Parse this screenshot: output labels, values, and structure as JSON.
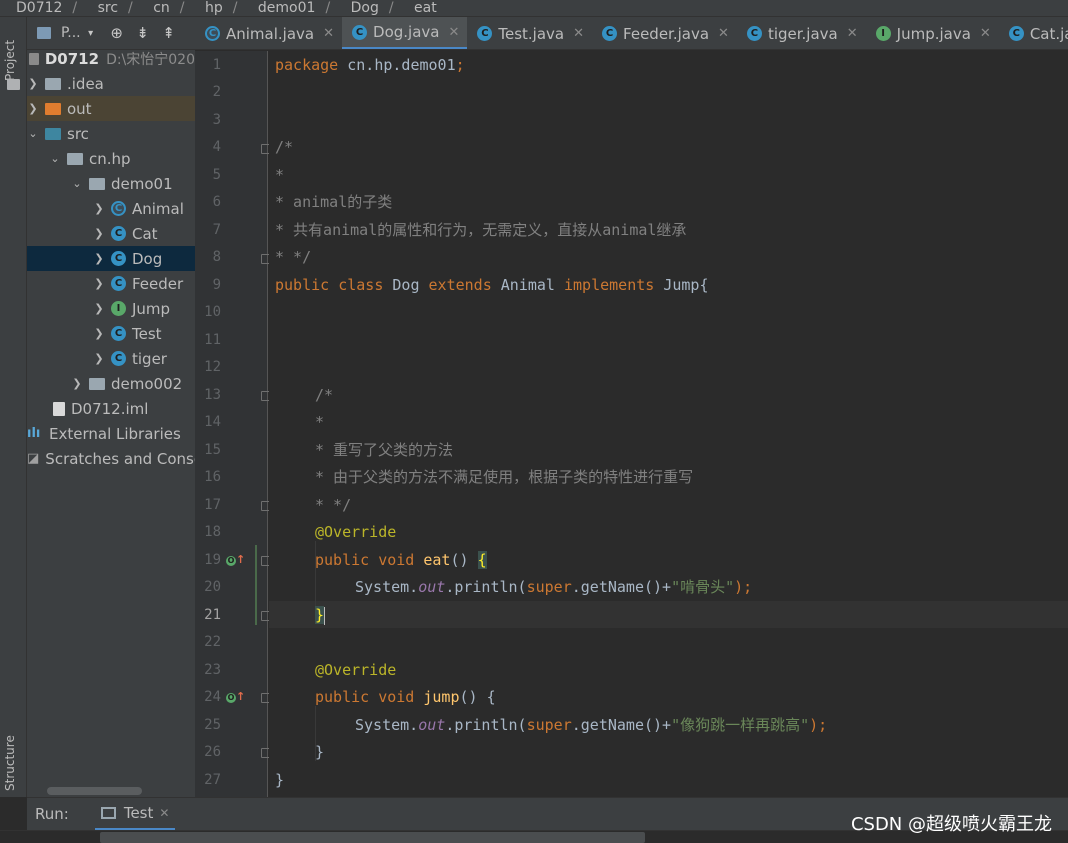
{
  "breadcrumb": [
    "D0712",
    "src",
    "cn",
    "hp",
    "demo01",
    "Dog",
    "eat"
  ],
  "left_stripe": {
    "project": "Project",
    "structure": "Structure"
  },
  "project_panel": {
    "title": "P..."
  },
  "tree": [
    {
      "label": "D0712",
      "extra": "D:\\宋怡宁020",
      "kind": "module"
    },
    {
      "label": ".idea",
      "kind": "folder"
    },
    {
      "label": "out",
      "kind": "folder-out"
    },
    {
      "label": "src",
      "kind": "folder-src"
    },
    {
      "label": "cn.hp",
      "kind": "package"
    },
    {
      "label": "demo01",
      "kind": "package"
    },
    {
      "label": "Animal",
      "kind": "class"
    },
    {
      "label": "Cat",
      "kind": "class"
    },
    {
      "label": "Dog",
      "kind": "class"
    },
    {
      "label": "Feeder",
      "kind": "class"
    },
    {
      "label": "Jump",
      "kind": "interface"
    },
    {
      "label": "Test",
      "kind": "class"
    },
    {
      "label": "tiger",
      "kind": "class"
    },
    {
      "label": "demo002",
      "kind": "package"
    },
    {
      "label": "D0712.iml",
      "kind": "file"
    },
    {
      "label": "External Libraries",
      "kind": "libs"
    },
    {
      "label": "Scratches and Consoles",
      "kind": "scratch"
    }
  ],
  "tabs": [
    {
      "label": "Animal.java",
      "icon": "class-icon"
    },
    {
      "label": "Dog.java",
      "icon": "class-icon",
      "active": true
    },
    {
      "label": "Test.java",
      "icon": "class-icon"
    },
    {
      "label": "Feeder.java",
      "icon": "class-icon"
    },
    {
      "label": "tiger.java",
      "icon": "class-icon"
    },
    {
      "label": "Jump.java",
      "icon": "interface-icon"
    },
    {
      "label": "Cat.java",
      "icon": "class-icon"
    }
  ],
  "line_numbers": [
    "1",
    "2",
    "3",
    "4",
    "5",
    "6",
    "7",
    "8",
    "9",
    "10",
    "11",
    "12",
    "13",
    "14",
    "15",
    "16",
    "17",
    "18",
    "19",
    "20",
    "21",
    "22",
    "23",
    "24",
    "25",
    "26",
    "27"
  ],
  "current_line": "21",
  "code": {
    "l1_a": "package",
    "l1_b": " cn.hp.demo01",
    "l1_c": ";",
    "l4": "/*",
    "l5": "*",
    "l6": "* animal的子类",
    "l7": "* 共有animal的属性和行为，无需定义，直接从animal继承",
    "l8": "* */",
    "l9_public": "public",
    "l9_class": "class",
    "l9_dog": "Dog",
    "l9_extends": "extends",
    "l9_animal": "Animal",
    "l9_implements": "implements",
    "l9_jump": "Jump{",
    "l13": "/*",
    "l14": "*",
    "l15": "* 重写了父类的方法",
    "l16": "* 由于父类的方法不满足使用，根据子类的特性进行重写",
    "l17": "* */",
    "l18": "@Override",
    "l19_public": "public",
    "l19_void": "void",
    "l19_fn": "eat",
    "l19_rest": "() ",
    "l19_brace": "{",
    "l20_sys": "System.",
    "l20_out": "out",
    "l20_print": ".println(",
    "l20_super": "super",
    "l20_get": ".getName()+",
    "l20_str": "\"啃骨头\"",
    "l20_end": ");",
    "l21": "}",
    "l23": "@Override",
    "l24_public": "public",
    "l24_void": "void",
    "l24_fn": "jump",
    "l24_rest": "() {",
    "l25_sys": "System.",
    "l25_out": "out",
    "l25_print": ".println(",
    "l25_super": "super",
    "l25_get": ".getName()+",
    "l25_str": "\"像狗跳一样再跳高\"",
    "l25_end": ");",
    "l26": "}",
    "l27": "}"
  },
  "run": {
    "label": "Run:",
    "tab": "Test"
  },
  "watermark": "CSDN @超级喷火霸王龙",
  "colors": {
    "accent": "#4a88c7",
    "selection": "#0d293e",
    "keyword": "#cc7832",
    "string": "#6a8759"
  }
}
